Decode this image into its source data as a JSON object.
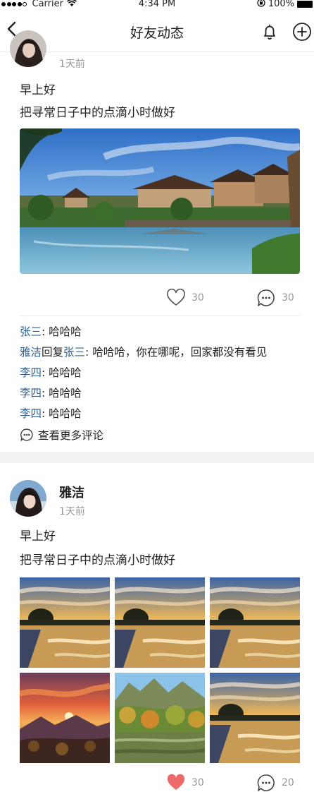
{
  "status_bar": {
    "carrier": "Carrier",
    "time": "4:34 PM",
    "battery": "100%"
  },
  "nav": {
    "title": "好友动态"
  },
  "post1": {
    "time": "1天前",
    "line1": "早上好",
    "line2": "把寻常日子中的点滴小时做好",
    "likes": "30",
    "comments_count": "30",
    "comments": [
      {
        "name": "张三",
        "sep": ": ",
        "text": "哈哈哈"
      },
      {
        "name": "雅洁",
        "reply_word": "回复",
        "reply_to": "张三",
        "sep": ": ",
        "text": "哈哈哈，你在哪呢，回家都没有看见"
      },
      {
        "name": "李四",
        "sep": ": ",
        "text": "哈哈哈"
      },
      {
        "name": "李四",
        "sep": ": ",
        "text": "哈哈哈"
      },
      {
        "name": "李四",
        "sep": ": ",
        "text": "哈哈哈"
      }
    ],
    "more_comments": "查看更多评论"
  },
  "post2": {
    "author": "雅洁",
    "time": "1天前",
    "line1": "早上好",
    "line2": "把寻常日子中的点滴小时做好",
    "likes": "30",
    "comments_count": "20"
  },
  "colors": {
    "name_link": "#2b5e93",
    "liked_heart": "#ef6b6b",
    "muted": "#999999",
    "divider": "#f2f2f4"
  },
  "icons": [
    "back-chevron-icon",
    "bell-icon",
    "add-circle-icon",
    "heart-outline-icon",
    "heart-filled-icon",
    "comment-bubble-icon"
  ]
}
